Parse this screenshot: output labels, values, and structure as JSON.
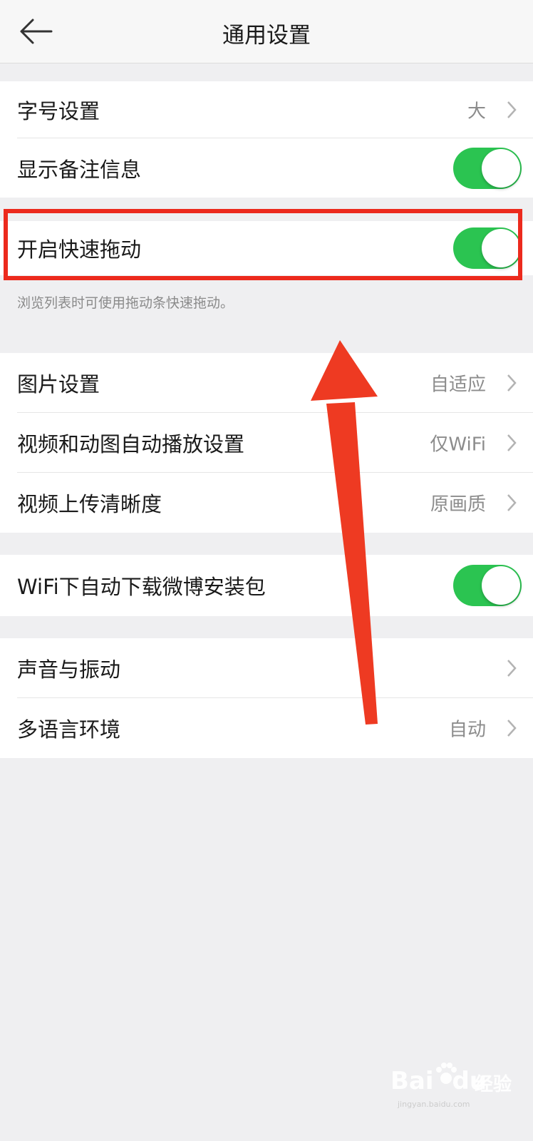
{
  "header": {
    "title": "通用设置"
  },
  "group1": [
    {
      "label": "字号设置",
      "value": "大",
      "control": "chevron"
    },
    {
      "label": "显示备注信息",
      "control": "toggle",
      "on": true
    }
  ],
  "group2": {
    "row": {
      "label": "开启快速拖动",
      "control": "toggle",
      "on": true
    },
    "hint": "浏览列表时可使用拖动条快速拖动。"
  },
  "group3": [
    {
      "label": "图片设置",
      "value": "自适应",
      "control": "chevron"
    },
    {
      "label": "视频和动图自动播放设置",
      "value": "仅WiFi",
      "control": "chevron"
    },
    {
      "label": "视频上传清晰度",
      "value": "原画质",
      "control": "chevron"
    }
  ],
  "group4": [
    {
      "label": "WiFi下自动下载微博安装包",
      "control": "toggle",
      "on": true
    }
  ],
  "group5": [
    {
      "label": "声音与振动",
      "control": "chevron"
    },
    {
      "label": "多语言环境",
      "value": "自动",
      "control": "chevron"
    }
  ],
  "watermark": {
    "brand": "Bai",
    "brand2": "du",
    "name": "经验",
    "url": "jingyan.baidu.com"
  },
  "colors": {
    "toggle_on": "#2bc451",
    "highlight": "#ec2a1d",
    "background": "#efeff1"
  },
  "icons": {
    "back": "arrow-left-icon",
    "chevron": "chevron-right-icon"
  }
}
